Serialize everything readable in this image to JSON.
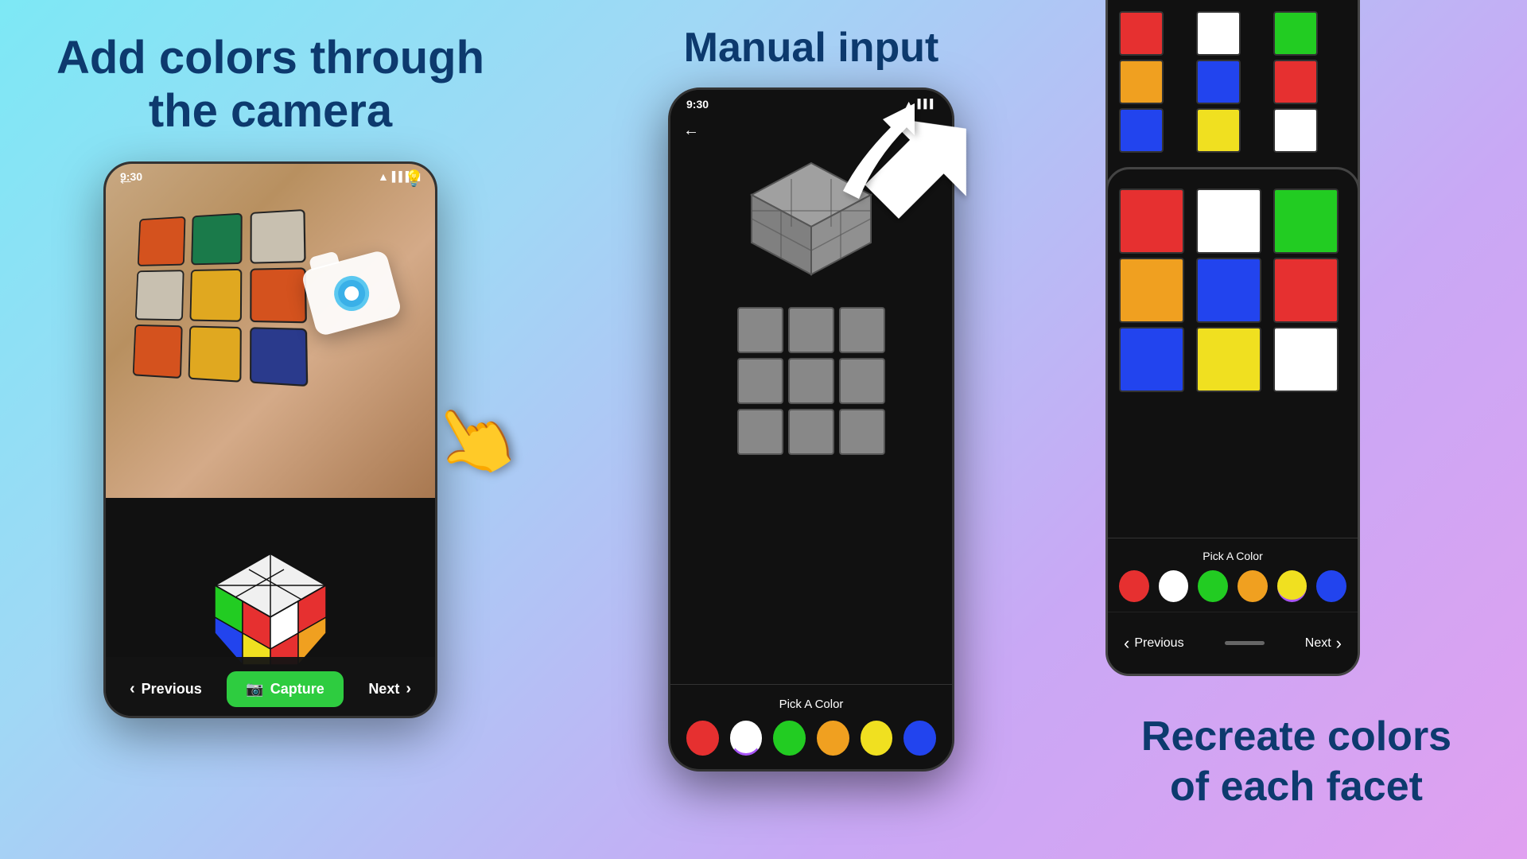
{
  "left": {
    "title_line1": "Add colors through",
    "title_line2": "the camera",
    "phone": {
      "time": "9:30",
      "camera_view_colors": [
        "#d4521e",
        "#1a7a4a",
        "#c8c0b0",
        "#c8c0b0",
        "#e0a820",
        "#d4521e",
        "#d4521e",
        "#e0a820",
        "#2a3a8c"
      ],
      "nav": {
        "previous": "Previous",
        "capture": "Capture",
        "next": "Next"
      }
    }
  },
  "middle": {
    "title": "Manual input",
    "phone": {
      "time": "9:30",
      "pick_a_color_label": "Pick A Color",
      "colors": [
        "#e63030",
        "#ffffff",
        "#22cc22",
        "#f0a020",
        "#f0e020",
        "#2244ee"
      ]
    }
  },
  "right": {
    "phone": {
      "face_colors_top": [
        "#e63030",
        "#ffffff",
        "#22cc22",
        "#f0a020",
        "#2244ee",
        "#e63030",
        "#2244ee",
        "#f0e020",
        "#ffffff"
      ],
      "face_colors_bottom": [
        "#e63030",
        "#ffffff",
        "#22cc22",
        "#f0a020",
        "#2244ee",
        "#e63030",
        "#2244ee",
        "#f0e020",
        "#ffffff"
      ],
      "pick_a_color_label": "Pick A Color",
      "colors": [
        "#e63030",
        "#ffffff",
        "#22cc22",
        "#f0a020",
        "#f0e020",
        "#2244ee"
      ],
      "nav": {
        "previous": "Previous",
        "next": "Next"
      }
    },
    "bottom_text_line1": "Recreate colors",
    "bottom_text_line2": "of each facet"
  },
  "icons": {
    "wifi": "▲",
    "signal": "📶",
    "battery": "🔋",
    "back_arrow": "←",
    "bulb": "💡",
    "camera_icon": "📷",
    "chevron_left": "‹",
    "chevron_right": "›"
  }
}
